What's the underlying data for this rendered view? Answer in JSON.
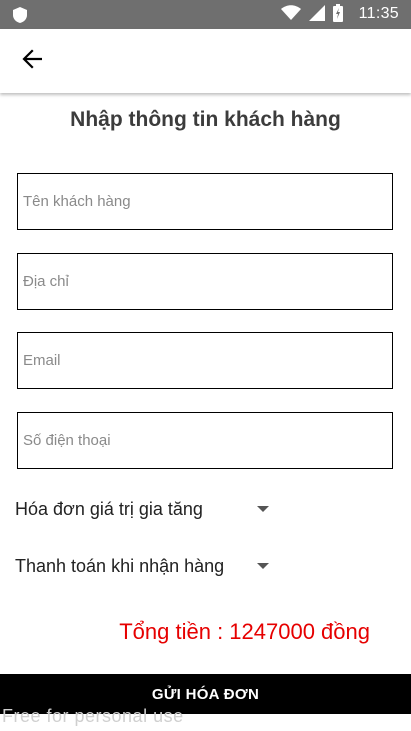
{
  "status_bar": {
    "time": "11:35",
    "icons": [
      "shield-icon",
      "wifi-icon",
      "signal-icon",
      "battery-icon"
    ]
  },
  "app_bar": {
    "back_icon": "arrow-left-icon"
  },
  "page": {
    "title": "Nhập thông tin khách hàng"
  },
  "form": {
    "customer_name": {
      "placeholder": "Tên khách hàng",
      "value": ""
    },
    "address": {
      "placeholder": "Địa chỉ",
      "value": ""
    },
    "email": {
      "placeholder": "Email",
      "value": ""
    },
    "phone": {
      "placeholder": "Số điện thoại",
      "value": ""
    },
    "invoice_type": {
      "selected": "Hóa đơn giá trị gia tăng"
    },
    "payment_method": {
      "selected": "Thanh toán khi nhận hàng"
    }
  },
  "summary": {
    "total_text": "Tổng tiền : 1247000 đồng"
  },
  "actions": {
    "submit_label": "GỬI HÓA ĐƠN"
  },
  "watermark": "Free for personal use",
  "colors": {
    "status_bar": "#6f6f6f",
    "total": "#e60000",
    "button": "#000000"
  }
}
